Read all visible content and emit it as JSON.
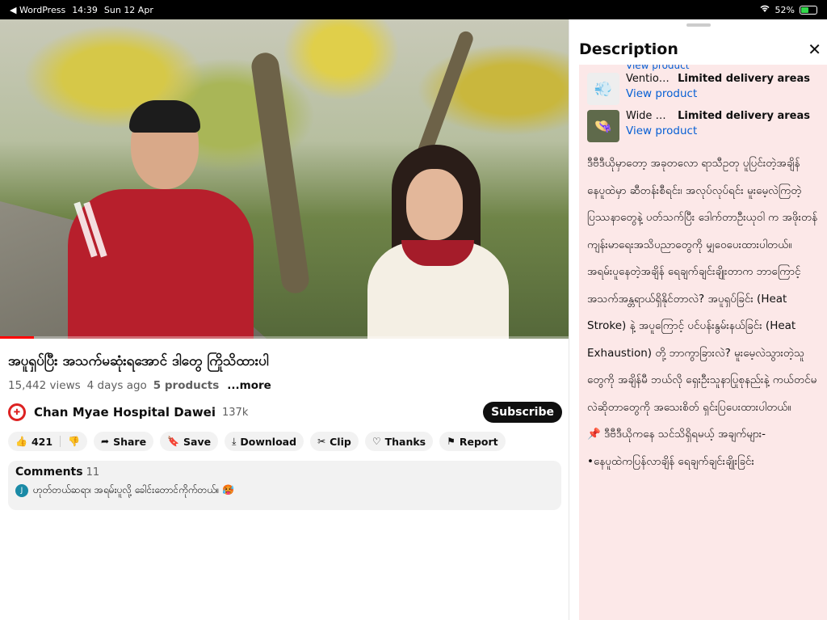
{
  "status_bar": {
    "back_app": "◀ WordPress",
    "time": "14:39",
    "date": "Sun 12 Apr",
    "wifi_icon": "wifi-icon",
    "battery_percent": "52%",
    "battery_level": 0.52
  },
  "video": {
    "progress": 0.06,
    "title": "အပူရှပ်ပြီး အသက်မဆုံးရအောင် ဒါတွေ ကြိုသိထားပါ",
    "views": "15,442 views",
    "age": "4 days ago",
    "products": "5 products",
    "more": "...more"
  },
  "channel": {
    "name": "Chan Myae Hospital Dawei",
    "subscribers": "137k",
    "subscribe_label": "Subscribe"
  },
  "actions": {
    "likes": "421",
    "share": "Share",
    "save": "Save",
    "download": "Download",
    "clip": "Clip",
    "thanks": "Thanks",
    "report": "Report"
  },
  "comments": {
    "label": "Comments",
    "count": "11",
    "top_avatar": "J",
    "top_text": "ဟုတ်တယ်ဆရာ၊ အရမ်းပူလို့ ခေါင်းတောင်ကိုက်တယ်။ 🥵"
  },
  "panel": {
    "title": "Description",
    "partial_link": "View product",
    "products": [
      {
        "name": "Vention Ha...",
        "note": "Limited delivery areas",
        "link": "View product"
      },
      {
        "name": "Wide Brim...",
        "note": "Limited delivery areas",
        "link": "View product"
      }
    ],
    "description": "ဒီဗီဒီယိုမှာတော့ အခုတလော ရာသီဥတု ပူပြင်းတဲ့အချိန် နေပူထဲမှာ ဆီတန်းစီရင်း၊ အလုပ်လုပ်ရင်း မူးမေ့လဲကြတဲ့ ပြဿနာတွေနဲ့ ပတ်သက်ပြီး ဒေါက်တာဦးယုဝါ က အဖိုးတန် ကျန်းမာရေးအသိပညာတွေကို မျှဝေပေးထားပါတယ်။\nအရမ်းပူနေတဲ့အချိန် ရေချက်ချင်းချိုးတာက ဘာကြောင့် အသက်အန္တရာယ်ရှိနိုင်တာလဲ? အပူရှပ်ခြင်း (Heat Stroke) နဲ့ အပူကြောင့် ပင်ပန်းနွမ်းနယ်ခြင်း (Heat Exhaustion) တို့ ဘာကွာခြားလဲ? မူးမေ့လဲသွားတဲ့သူတွေကို အချိန်မီ ဘယ်လို ရှေးဦးသူနာပြုစုနည်းနဲ့ ကယ်တင်မလဲဆိုတာတွေကို အသေးစိတ် ရှင်းပြပေးထားပါတယ်။\n📌 ဒီဗီဒီယိုကနေ သင်သိရှိရမယ့် အချက်များ-\n•နေပူထဲကပြန်လာချိန် ရေချက်ချင်းချိုးခြင်း"
  }
}
